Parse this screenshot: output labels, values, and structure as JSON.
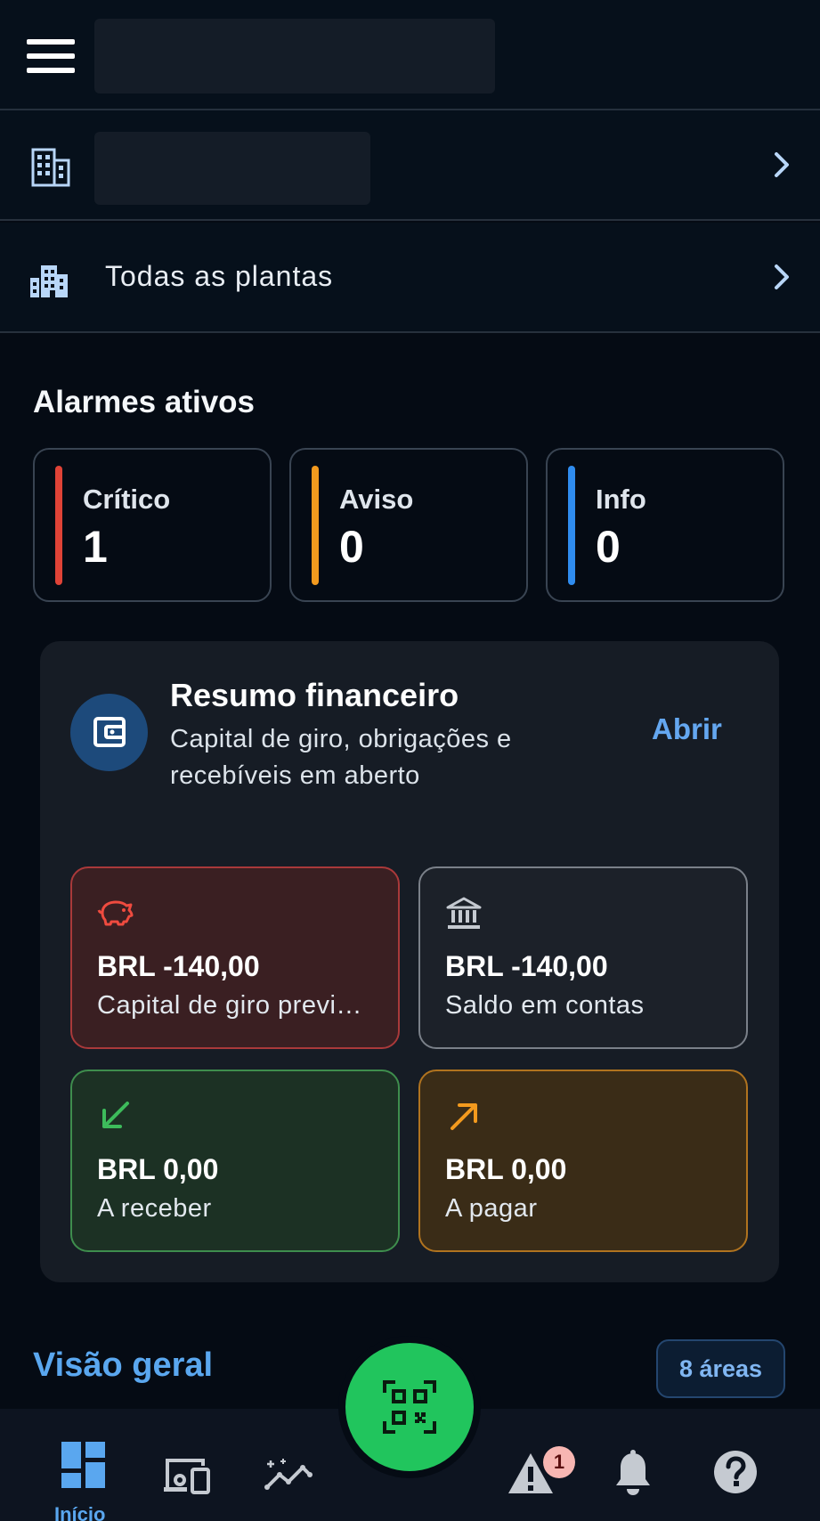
{
  "header": {
    "menu_icon": "hamburger-menu-icon"
  },
  "rows": {
    "company_icon": "building-icon",
    "plants_label": "Todas as plantas",
    "plants_icon": "buildings-icon",
    "chevron_icon": "chevron-right-icon"
  },
  "alarms": {
    "title": "Alarmes ativos",
    "items": [
      {
        "label": "Crítico",
        "count": "1",
        "color": "#e04337"
      },
      {
        "label": "Aviso",
        "count": "0",
        "color": "#f39a1e"
      },
      {
        "label": "Info",
        "count": "0",
        "color": "#2f8cef"
      }
    ]
  },
  "finance": {
    "title": "Resumo financeiro",
    "subtitle": "Capital de giro, obrigações e recebíveis em aberto",
    "open_label": "Abrir",
    "icon": "wallet-icon",
    "cards": [
      {
        "value": "BRL -140,00",
        "label": "Capital de giro previ…",
        "icon": "piggy-bank-icon",
        "accent": "#e04337"
      },
      {
        "value": "BRL -140,00",
        "label": "Saldo em contas",
        "icon": "bank-icon",
        "accent": "#b8bec6"
      },
      {
        "value": "BRL 0,00",
        "label": "A receber",
        "icon": "arrow-down-left-icon",
        "accent": "#3dbb5b"
      },
      {
        "value": "BRL 0,00",
        "label": "A pagar",
        "icon": "arrow-up-right-icon",
        "accent": "#f39a1e"
      }
    ]
  },
  "overview": {
    "title": "Visão geral",
    "badge": "8 áreas"
  },
  "bottom_nav": {
    "home_label": "Início",
    "alert_badge": "1",
    "items": [
      "dashboard-icon",
      "devices-icon",
      "analytics-icon",
      "qr-code-icon",
      "warning-icon",
      "bell-icon",
      "help-icon"
    ]
  },
  "colors": {
    "accent_blue": "#5aa7ef",
    "fab_green": "#21c55d",
    "background": "#050b14"
  }
}
